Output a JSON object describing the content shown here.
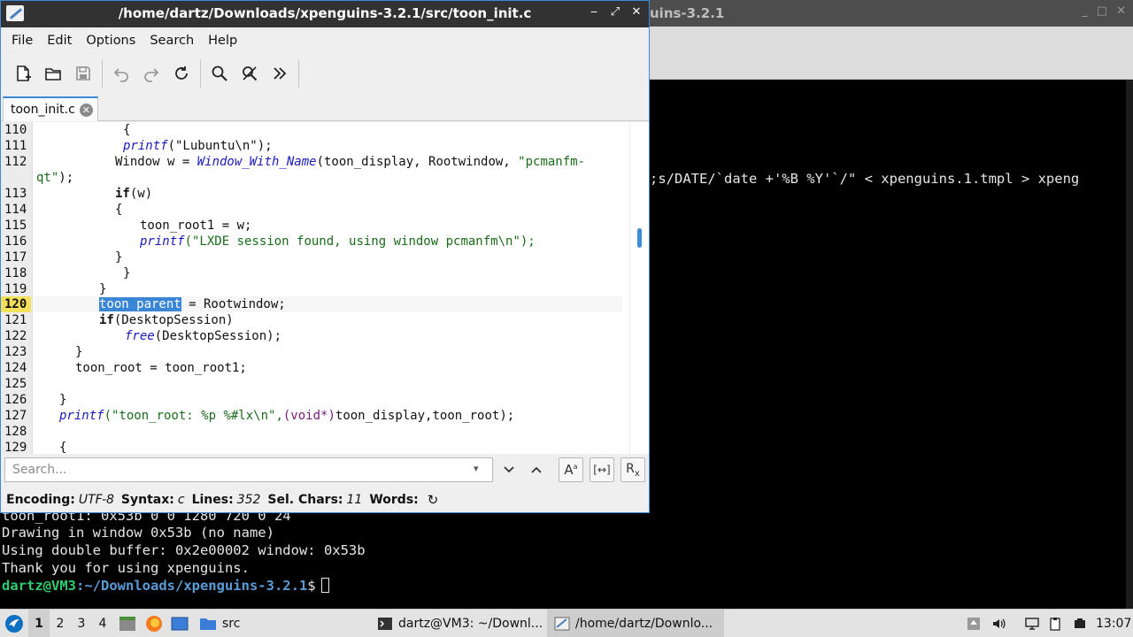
{
  "terminal": {
    "title": "uins-3.2.1",
    "window_controls": [
      "_",
      "□",
      "✕"
    ],
    "command_fragment": ";s/DATE/`date +'%B %Y'`/\" < xpenguins.1.tmpl > xpeng",
    "output_lines": [
      "toon_root1: 0x53b 0 0 1280 720 0 24",
      "Drawing in window 0x53b (no name)",
      "Using double buffer: 0x2e00002 window: 0x53b",
      "Thank you for using xpenguins."
    ],
    "prompt_user": "dartz@VM3",
    "prompt_path": ":~/Downloads/xpenguins-3.2.1",
    "prompt_dollar": "$"
  },
  "editor": {
    "title": "/home/dartz/Downloads/xpenguins-3.2.1/src/toon_init.c",
    "menu": [
      "File",
      "Edit",
      "Options",
      "Search",
      "Help"
    ],
    "toolbar_icons": [
      "new-file-icon",
      "open-folder-icon",
      "save-icon",
      "undo-icon",
      "redo-icon",
      "reload-icon",
      "find-icon",
      "replace-icon",
      "more-icon"
    ],
    "tab": {
      "label": "toon_init.c"
    },
    "line_numbers": [
      "110",
      "111",
      "112",
      "",
      "113",
      "114",
      "115",
      "116",
      "117",
      "118",
      "119",
      "120",
      "121",
      "122",
      "123",
      "124",
      "125",
      "126",
      "127",
      "128",
      "129"
    ],
    "current_line": "120",
    "code": {
      "l110": "{",
      "l111_fn": "printf",
      "l111_rest": "(\"Lubuntu\\n\");",
      "l112_a": "Window w = ",
      "l112_fn": "Window_With_Name",
      "l112_b": "(toon_display, Rootwindow, ",
      "l112_str": "\"pcmanfm-",
      "l112w_str": "qt\"",
      "l112w_rest": ");",
      "l113_kw": "if",
      "l113_rest": "(w)",
      "l114": "{",
      "l115": "toon_root1 = w;",
      "l116_fn": "printf",
      "l116_str": "(\"LXDE session found, using window pcmanfm\\n\");",
      "l117": "}",
      "l118": "}",
      "l119": "}",
      "l120_sel": "toon parent",
      "l120_rest": " = Rootwindow;",
      "l121_kw": "if",
      "l121_rest": "(DesktopSession)",
      "l122_fn": "free",
      "l122_rest": "(DesktopSession);",
      "l123": "}",
      "l124": "toon_root = toon_root1;",
      "l126": "}",
      "l127_fn": "printf",
      "l127_str": "(\"toon_root: %p %#lx\\n\",",
      "l127_ty": "(void*)",
      "l127_rest": "toon_display,toon_root);",
      "l129": "{"
    },
    "search": {
      "placeholder": "Search...",
      "buttons": [
        "chevron-down-icon",
        "chevron-up-icon",
        "match-case-icon",
        "whole-word-icon",
        "regex-icon"
      ]
    },
    "status": {
      "encoding_label": "Encoding:",
      "encoding_value": "UTF-8",
      "syntax_label": "Syntax:",
      "syntax_value": "c",
      "lines_label": "Lines:",
      "lines_value": "352",
      "selchars_label": "Sel. Chars:",
      "selchars_value": "11",
      "words_label": "Words:"
    }
  },
  "taskbar": {
    "workspaces": [
      "1",
      "2",
      "3",
      "4"
    ],
    "active_workspace": "1",
    "folder_label": "src",
    "tasks": [
      {
        "label": "dartz@VM3: ~/Downl...",
        "icon": "terminal-icon"
      },
      {
        "label": "/home/dartz/Downlo...",
        "icon": "text-editor-icon"
      }
    ],
    "clock": "13:07"
  },
  "colors": {
    "accent": "#3b8bd9",
    "current_line_number": "#f5e05c",
    "prompt_user": "#2ecc71",
    "prompt_path": "#5b9bd5"
  }
}
